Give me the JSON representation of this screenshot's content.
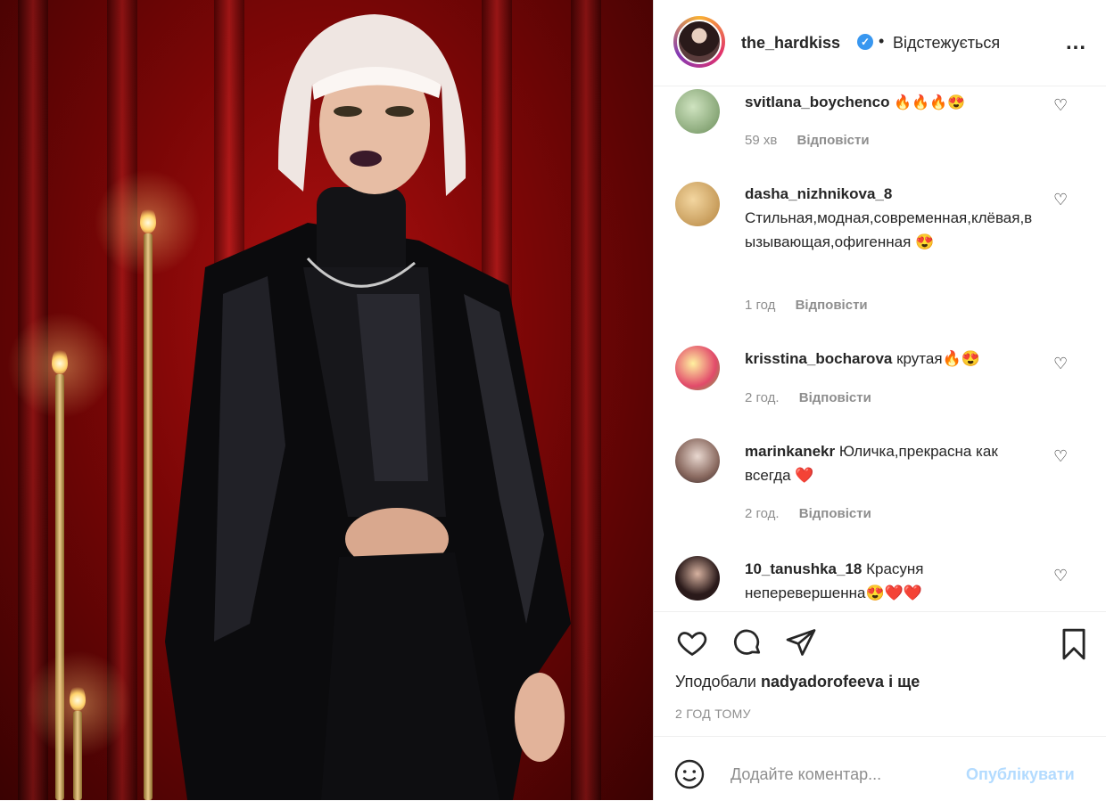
{
  "header": {
    "username": "the_hardkiss",
    "verified_icon": "verified-badge-icon",
    "separator": "•",
    "follow_status": "Відстежується",
    "more_label": "..."
  },
  "comments": [
    {
      "user": "svitlana_boychenco",
      "text": "🔥🔥🔥😍",
      "time": "59 хв",
      "reply": "Відповісти"
    },
    {
      "user": "dasha_nizhnikova_8",
      "text": "Стильная,модная,современная,клёвая,вызывающая,офигенная 😍",
      "time": "1 год",
      "reply": "Відповісти"
    },
    {
      "user": "krisstina_bocharova",
      "text": "крутая🔥😍",
      "time": "2 год.",
      "reply": "Відповісти"
    },
    {
      "user": "marinkanekr",
      "text": "Юличка,прекрасна как всегда ❤️",
      "time": "2 год.",
      "reply": "Відповісти"
    },
    {
      "user": "10_tanushka_18",
      "text": "Красуня неперевершенна😍❤️❤️",
      "time": "",
      "reply": ""
    }
  ],
  "actions": {
    "likes_prefix": "Уподобали",
    "likes_user": "nadyadorofeeva",
    "likes_suffix": "і ще",
    "time_ago": "2 ГОД ТОМУ"
  },
  "add_comment": {
    "placeholder": "Додайте коментар...",
    "publish_label": "Опублікувати"
  },
  "colors": {
    "accent_link": "#3897f0",
    "publish_disabled": "#b3dbff",
    "heart_red": "#ed4956",
    "meta_grey": "#8e8e8e"
  }
}
